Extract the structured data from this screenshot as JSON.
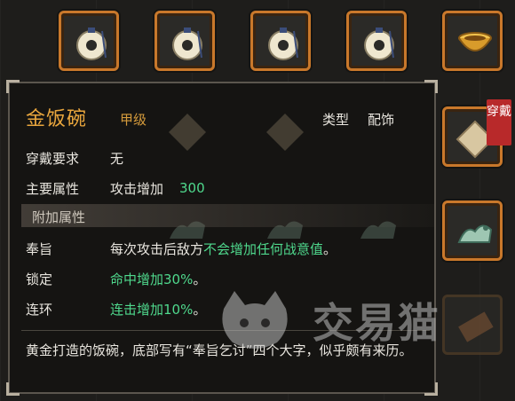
{
  "item": {
    "name": "金饭碗",
    "grade": "甲级",
    "type_label": "类型",
    "type_value": "配饰",
    "requirement_label": "穿戴要求",
    "requirement_value": "无",
    "main_attr_label": "主要属性",
    "main_attr_text": "攻击增加",
    "main_attr_value": "300",
    "extra_section_title": "附加属性",
    "extras": [
      {
        "label": "奉旨",
        "prefix": "每次攻击后敌方",
        "effect": "不会增加任何战意值",
        "suffix": "。"
      },
      {
        "label": "锁定",
        "prefix": "",
        "effect": "命中增加30%",
        "suffix": "。"
      },
      {
        "label": "连环",
        "prefix": "",
        "effect": "连击增加10%",
        "suffix": "。"
      }
    ],
    "description": "黄金打造的饭碗，底部写有“奉旨乞讨”四个大字，似乎颇有来历。"
  },
  "badge_text": "穿戴",
  "watermark": "交易猫",
  "icons": {
    "slot_1": "jade-pendant-icon",
    "slot_2": "jade-pendant-icon",
    "slot_3": "jade-pendant-icon",
    "slot_4": "jade-pendant-icon",
    "slot_5": "golden-bowl-icon",
    "slot_6": "parchment-icon",
    "slot_7": "jade-dragon-icon",
    "slot_8": "brown-scroll-icon"
  },
  "colors": {
    "item_name": "#e9a63d",
    "effect_green": "#4fd98d",
    "slot_border": "#c9782b",
    "badge": "#b8292a"
  }
}
